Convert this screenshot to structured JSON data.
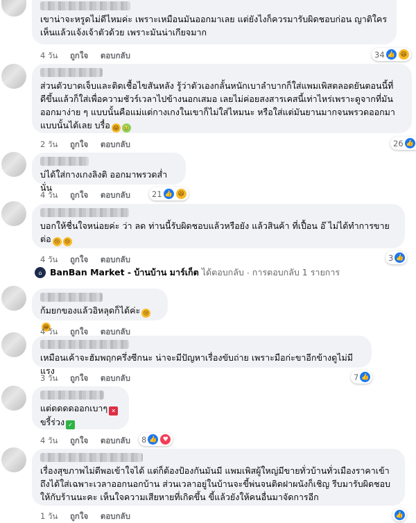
{
  "comments": [
    {
      "text": "เขาน่าจะหรูดไม่ดีไหมค่ะ เพราะเหมือนมันออกมาเลย แต่ยังไงก็ควรมารับผิดชอบก่อน ญาติใคร\nเห็นแล้วแจ้งเจ้าตัวด้วย เพราะมันน่าเกียจมาก",
      "time": "4 วัน",
      "like": "ถูกใจ",
      "reply": "ตอบกลับ",
      "reaction_count": "34",
      "reactions": [
        "like-icon",
        "haha-icon"
      ]
    },
    {
      "text": "ส่วนตัวบาดเจ็บและติดเชื้อไขสันหลัง รู้ว่าตัวเองกลั้นหนักเบาลำบากก็ใส่แพมเพิสตลอดยันตอนนี้ที่\nดีขึ้นแล้วก็ใส่เพื่อความชัวร์เวลาไปข้างนอกเสมอ เลยไม่ค่อยสงสารเคสนี้เท่าไหร่เพราะดูจากที่มัน\nออกมาง่าย ๆ แบบนั้นคือแม่แต่กางเกงในเขาก็ไม่ใส่ไหมนะ หรือใส่แต่มันยานมากจนพรวดออกมา\nแบบนั้นได้เลย บรื๋อ",
      "emoji": [
        "scream-emoji",
        "sick-emoji"
      ],
      "time": "2 วัน",
      "like": "ถูกใจ",
      "reply": "ตอบกลับ",
      "reaction_count": "26",
      "reactions": [
        "like-icon",
        "haha-icon"
      ]
    },
    {
      "text": "บ่ได้ใส่กางเกงลิงติ ออกมาพรวดส่ำนั่น",
      "time": "4 วัน",
      "like": "ถูกใจ",
      "reply": "ตอบกลับ",
      "reaction_count": "21",
      "reactions": [
        "like-icon",
        "haha-icon"
      ]
    },
    {
      "text": "บอกให้ชื่นใจหน่อยค่ะ ว่า ลด ท่านนี้รับผิดชอบแล้วหรือยัง แล้วสินค้า ที่เปื้อน อ๊ ไม่ได้ทำการขาย\nต่อ",
      "emoji": [
        "sad-emoji",
        "sad-emoji"
      ],
      "time": "4 วัน",
      "like": "ถูกใจ",
      "reply": "ตอบกลับ",
      "reaction_count": "3",
      "reactions": [
        "like-icon"
      ]
    },
    {
      "text": "ก้มยกของแล้วอิหลุดก็ได้ค่ะ",
      "emoji": [
        "sad-emoji",
        "laugh-emoji"
      ],
      "time": "4 วัน",
      "like": "ถูกใจ",
      "reply": "ตอบกลับ"
    },
    {
      "text": "เหมือนเค้าจะฮัมพฤกครึ่งซีกนะ น่าจะมีปัญหาเรื่องขับถ่าย เพราะมือก่ะขาอีกข้างดูไม่มีแรง",
      "time": "3 วัน",
      "like": "ถูกใจ",
      "reply": "ตอบกลับ",
      "reaction_count": "7",
      "reactions": [
        "like-icon"
      ]
    },
    {
      "text_line1": "แต่ดดดดออกเบาๆ",
      "text_line2": "ขรี้ร่วง",
      "time": "4 วัน",
      "like": "ถูกใจ",
      "reply": "ตอบกลับ",
      "reaction_count": "8",
      "reactions": [
        "like-icon",
        "love-icon"
      ]
    },
    {
      "text": "เรื่องสุขภาพไม่ดีพอเข้าใจได้ แต่ก็ต้องป้องกันมันมี แพมเพิสผู้ใหญ่มีขายทั่วบ้านทั่วเมืองราคาเข้า\nถึงได้ใส่เฉพาะเวลาออกนอกบ้าน ส่วนเวลาอยู่ในบ้านจะขี้พ่นจนติดฝาผนังก็เชิญ รีบมารับผิดชอบ\nให้กับร้านนะคะ เห็นใจความเสียหายที่เกิดขึ้น ขี้แล้วยังให้คนอื่นมาจัดการอีก",
      "time": "1 วัน",
      "like": "ถูกใจ",
      "reply": "ตอบกลับ"
    }
  ],
  "page_reply": {
    "page_name": "BanBan Market - บ้านบ้าน มาร์เก็ต",
    "action": "ได้ตอบกลับ",
    "separator": "·",
    "count_text": "การตอบกลับ 1 รายการ"
  }
}
